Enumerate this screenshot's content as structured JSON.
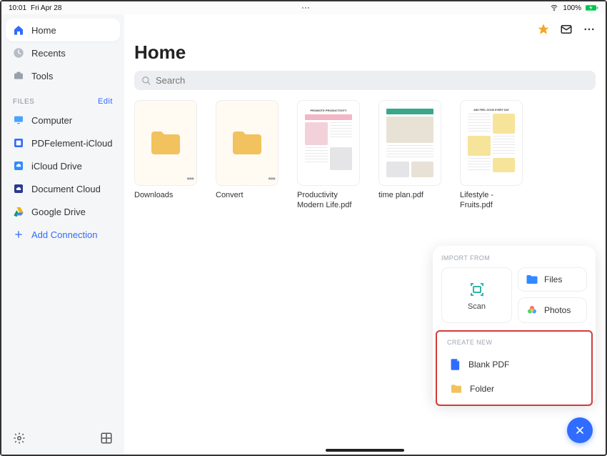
{
  "statusbar": {
    "time": "10:01",
    "date": "Fri Apr 28",
    "battery": "100%"
  },
  "sidebar": {
    "nav": [
      {
        "id": "home",
        "label": "Home"
      },
      {
        "id": "recents",
        "label": "Recents"
      },
      {
        "id": "tools",
        "label": "Tools"
      }
    ],
    "files_header": "FILES",
    "edit_label": "Edit",
    "locations": [
      {
        "id": "computer",
        "label": "Computer"
      },
      {
        "id": "pdfelement-icloud",
        "label": "PDFelement-iCloud"
      },
      {
        "id": "icloud-drive",
        "label": "iCloud Drive"
      },
      {
        "id": "document-cloud",
        "label": "Document Cloud"
      },
      {
        "id": "google-drive",
        "label": "Google Drive"
      }
    ],
    "add_connection": "Add Connection"
  },
  "main": {
    "title": "Home",
    "search_placeholder": "Search",
    "items": [
      {
        "type": "folder",
        "label": "Downloads"
      },
      {
        "type": "folder",
        "label": "Convert"
      },
      {
        "type": "file",
        "label": "Productivity Modern Life.pdf"
      },
      {
        "type": "file",
        "label": "time plan.pdf"
      },
      {
        "type": "file",
        "label": "Lifestyle - Fruits.pdf"
      }
    ]
  },
  "popup": {
    "import_label": "IMPORT FROM",
    "scan": "Scan",
    "files": "Files",
    "photos": "Photos",
    "create_label": "CREATE NEW",
    "blank_pdf": "Blank PDF",
    "folder": "Folder"
  }
}
